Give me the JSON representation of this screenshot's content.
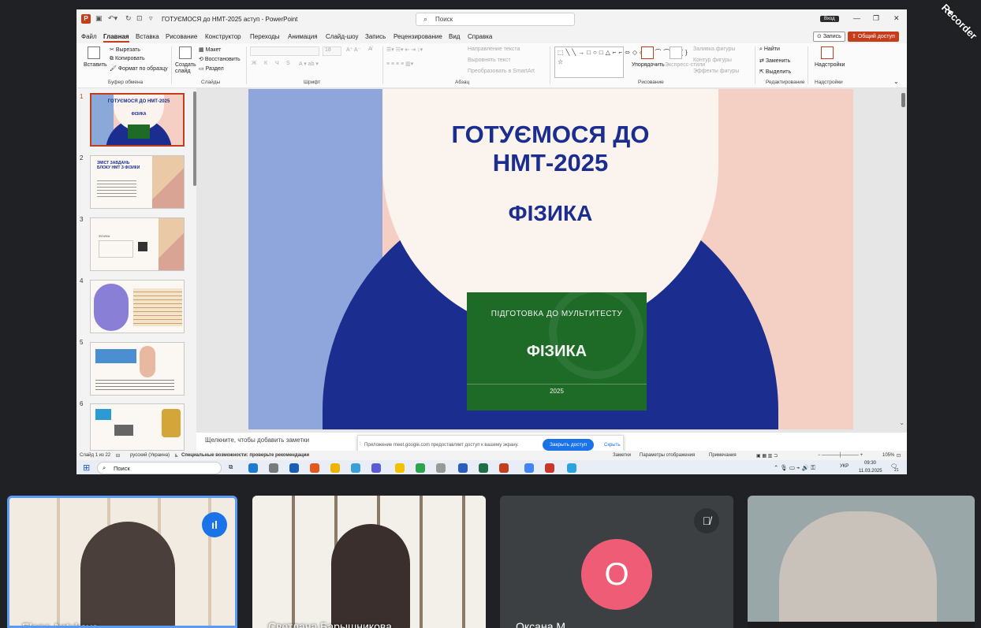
{
  "window": {
    "title": "ГОТУЄМОСЯ до НМТ-2025 аступ  -  PowerPoint",
    "search_placeholder": "Поиск",
    "sign_in": "Вход",
    "recorder_watermark": "Recorder"
  },
  "menu": {
    "tabs": [
      "Файл",
      "Главная",
      "Вставка",
      "Рисование",
      "Конструктор",
      "Переходы",
      "Анимация",
      "Слайд-шоу",
      "Запись",
      "Рецензирование",
      "Вид",
      "Справка"
    ],
    "active": "Главная",
    "record_btn": "Запись",
    "share_btn": "Общий доступ"
  },
  "ribbon": {
    "clipboard": {
      "paste": "Вставить",
      "cut": "Вырезать",
      "copy": "Копировать",
      "format_painter": "Формат по образцу",
      "label": "Буфер обмена"
    },
    "slides": {
      "new_slide": "Создать слайд",
      "layout": "Макет",
      "reset": "Восстановить",
      "section": "Раздел",
      "label": "Слайды"
    },
    "font": {
      "label": "Шрифт",
      "bold": "Ж",
      "italic": "К",
      "underline": "Ч",
      "strike": "S",
      "size": "18"
    },
    "paragraph": {
      "text_direction": "Направление текста",
      "align_text": "Выровнять текст",
      "smartart": "Преобразовать в SmartArt",
      "label": "Абзац"
    },
    "drawing": {
      "arrange": "Упорядочить",
      "quick_styles": "Экспресс-стили",
      "fill": "Заливка фигуры",
      "outline": "Контур фигуры",
      "effects": "Эффекты фигуры",
      "label": "Рисование",
      "shapes": "⬚╲╲→□○□△⌐⌐⬄◇◇☆⌒⌒⌒{}☆"
    },
    "editing": {
      "find": "Найти",
      "replace": "Заменить",
      "select": "Выделить",
      "label": "Редактирование"
    },
    "addins": {
      "label": "Надстройки",
      "btn": "Надстройки"
    }
  },
  "thumbnails": [
    {
      "num": "1",
      "title": "ГОТУЄМОСЯ ДО НМТ-2025",
      "sub": "ФІЗИКА"
    },
    {
      "num": "2",
      "title": "ЗМІСТ ЗАВДАНЬ БЛОКУ НМТ З ФІЗИКИ"
    },
    {
      "num": "3",
      "title": "ФІЗИКА"
    },
    {
      "num": "4"
    },
    {
      "num": "5"
    },
    {
      "num": "6"
    }
  ],
  "slide": {
    "title": "ГОТУЄМОСЯ ДО НМТ-2025",
    "subject": "ФІЗИКА",
    "book": {
      "top": "ПІДГОТОВКА ДО МУЛЬТИТЕСТУ",
      "title": "ФІЗИКА",
      "year": "2025"
    }
  },
  "notes_placeholder": "Щелкните, чтобы добавить заметки",
  "share_toast": {
    "message": "Приложение meet.google.com предоставляет доступ к вашему экрану.",
    "button": "Закрыть доступ",
    "hide": "Скрыть"
  },
  "status": {
    "slide_count": "Слайд 1 из 22",
    "language": "русский (Украина)",
    "accessibility": "Специальные возможности: проверьте рекомендации",
    "notes": "Заметки",
    "view_params": "Параметры отображения",
    "comments": "Примечания",
    "zoom": "105%"
  },
  "taskbar": {
    "search": "Поиск",
    "lang": "УКР",
    "time": "09:30",
    "date": "11.03.2025",
    "badge": "21"
  },
  "participants": [
    {
      "name": "Elena Antykova",
      "speaking": true
    },
    {
      "name": "Светлана Барышникова",
      "speaking": false
    },
    {
      "name": "Оксана М",
      "initial": "О",
      "muted": true
    },
    {
      "name": ""
    }
  ],
  "colors": {
    "accent": "#c43e1c",
    "navy": "#1b2d8e",
    "green": "#1e6b28",
    "toast_blue": "#1a73e8",
    "avatar": "#ee5d75"
  }
}
